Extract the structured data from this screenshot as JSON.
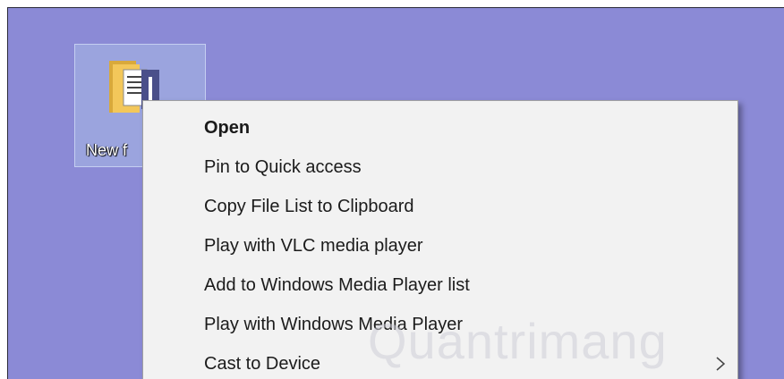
{
  "desktop": {
    "background_color": "#8b8ad6",
    "folder_icon": {
      "icon": "folder-icon",
      "label": "New f"
    }
  },
  "context_menu": {
    "items": [
      {
        "label": "Open",
        "bold": true
      },
      {
        "label": "Pin to Quick access"
      },
      {
        "label": "Copy File List to Clipboard"
      },
      {
        "label": "Play with VLC media player"
      },
      {
        "label": "Add to Windows Media Player list"
      },
      {
        "label": "Play with Windows Media Player"
      },
      {
        "label": "Cast to Device",
        "submenu": true,
        "submenu_icon": "chevron-right-icon"
      }
    ]
  },
  "watermark": {
    "text": "Quantrimang"
  }
}
